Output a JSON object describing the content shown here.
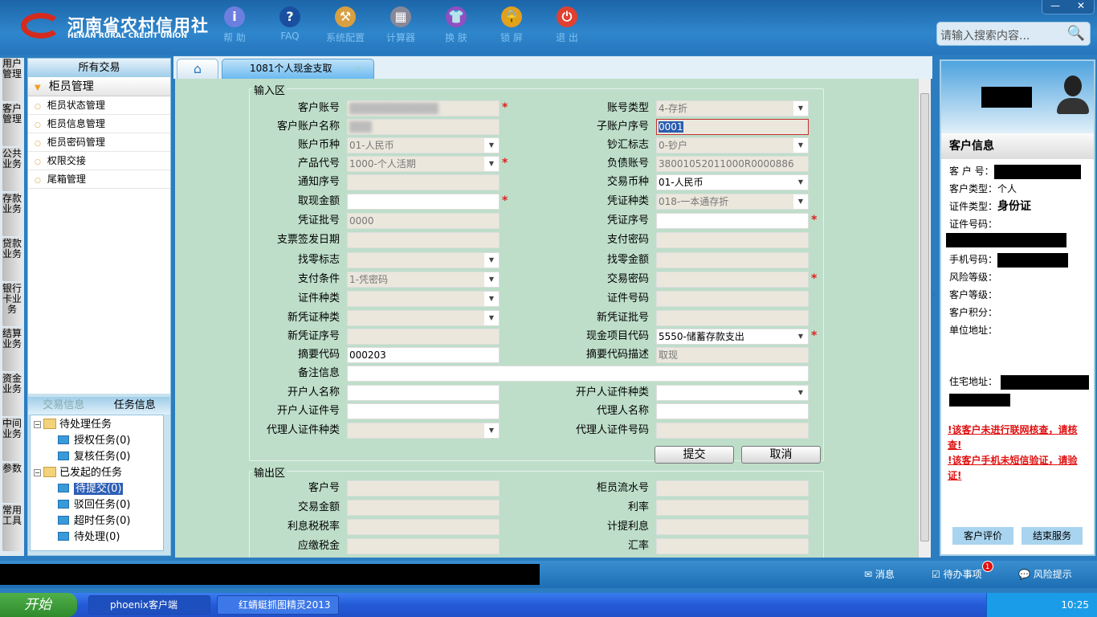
{
  "header": {
    "logo_cn": "河南省农村信用社",
    "logo_en": "HENAN RURAL CREDIT UNION",
    "tools": [
      {
        "label": "帮 助",
        "icon": "info-icon",
        "color": "#6c7fe0",
        "glyph": "i"
      },
      {
        "label": "FAQ",
        "icon": "question-icon",
        "color": "#1a4fa0",
        "glyph": "?"
      },
      {
        "label": "系统配置",
        "icon": "toolbox-icon",
        "color": "#d8a040",
        "glyph": "⚒"
      },
      {
        "label": "计算器",
        "icon": "calculator-icon",
        "color": "#889",
        "glyph": "▦"
      },
      {
        "label": "换 肤",
        "icon": "shirt-icon",
        "color": "#9050c0",
        "glyph": "👕"
      },
      {
        "label": "锁 屏",
        "icon": "lock-icon",
        "color": "#e0a020",
        "glyph": "🔒"
      },
      {
        "label": "退 出",
        "icon": "power-icon",
        "color": "#e04030",
        "glyph": "⏻"
      }
    ],
    "minimize": "—",
    "close": "✕",
    "search_placeholder": "请输入搜索内容..."
  },
  "vtabs": [
    "用户管理",
    "客户管理",
    "公共业务",
    "存款业务",
    "贷款业务",
    "银行卡业务",
    "结算业务",
    "资金业务",
    "中间业务",
    "参数",
    "常用工具"
  ],
  "left": {
    "title": "所有交易",
    "category": "柜员管理",
    "items": [
      "柜员状态管理",
      "柜员信息管理",
      "柜员密码管理",
      "权限交接",
      "尾箱管理"
    ],
    "tabs": [
      "交易信息",
      "任务信息"
    ],
    "tree": [
      {
        "label": "待处理任务",
        "children": [
          "授权任务(0)",
          "复核任务(0)"
        ]
      },
      {
        "label": "已发起的任务",
        "children": [
          "待提交(0)",
          "驳回任务(0)",
          "超时任务(0)",
          "待处理(0)"
        ]
      }
    ]
  },
  "tabs": {
    "active": "1081个人现金支取"
  },
  "form": {
    "input_title": "输入区",
    "output_title": "输出区",
    "submit": "提交",
    "cancel": "取消",
    "rows": [
      [
        {
          "label": "客户账号",
          "value": "████████████",
          "state": "blur",
          "req": true
        },
        {
          "label": "账号类型",
          "value": "4-存折",
          "state": "gray",
          "select": true
        }
      ],
      [
        {
          "label": "客户账户名称",
          "value": "███",
          "state": "blur"
        },
        {
          "label": "子账户序号",
          "value": "0001",
          "state": "active"
        }
      ],
      [
        {
          "label": "账户币种",
          "value": "01-人民币",
          "state": "gray",
          "select": true
        },
        {
          "label": "钞汇标志",
          "value": "0-钞户",
          "state": "gray",
          "select": true
        }
      ],
      [
        {
          "label": "产品代号",
          "value": "1000-个人活期",
          "state": "gray",
          "select": true,
          "req": true
        },
        {
          "label": "负债账号",
          "value": "38001052011000R0000886",
          "state": "gray"
        }
      ],
      [
        {
          "label": "通知序号",
          "value": "",
          "state": "gray"
        },
        {
          "label": "交易币种",
          "value": "01-人民币",
          "state": "white",
          "select": true
        }
      ],
      [
        {
          "label": "取现金额",
          "value": "",
          "state": "white",
          "req": true
        },
        {
          "label": "凭证种类",
          "value": "018-一本通存折",
          "state": "gray",
          "select": true
        }
      ],
      [
        {
          "label": "凭证批号",
          "value": "0000",
          "state": "gray"
        },
        {
          "label": "凭证序号",
          "value": "",
          "state": "white",
          "req": true
        }
      ],
      [
        {
          "label": "支票签发日期",
          "value": "",
          "state": "gray"
        },
        {
          "label": "支付密码",
          "value": "",
          "state": "gray"
        }
      ],
      [
        {
          "label": "找零标志",
          "value": "",
          "state": "gray",
          "select": true
        },
        {
          "label": "找零金额",
          "value": "",
          "state": "gray"
        }
      ],
      [
        {
          "label": "支付条件",
          "value": "1-凭密码",
          "state": "gray",
          "select": true
        },
        {
          "label": "交易密码",
          "value": "",
          "state": "gray",
          "req": true
        }
      ],
      [
        {
          "label": "证件种类",
          "value": "",
          "state": "gray",
          "select": true
        },
        {
          "label": "证件号码",
          "value": "",
          "state": "gray"
        }
      ],
      [
        {
          "label": "新凭证种类",
          "value": "",
          "state": "gray",
          "select": true
        },
        {
          "label": "新凭证批号",
          "value": "",
          "state": "gray"
        }
      ],
      [
        {
          "label": "新凭证序号",
          "value": "",
          "state": "gray"
        },
        {
          "label": "现金项目代码",
          "value": "5550-储蓄存款支出",
          "state": "white",
          "select": true,
          "req": true
        }
      ],
      [
        {
          "label": "摘要代码",
          "value": "000203",
          "state": "white"
        },
        {
          "label": "摘要代码描述",
          "value": "取现",
          "state": "gray"
        }
      ],
      [
        {
          "label": "备注信息",
          "value": "",
          "state": "white",
          "wide": true
        }
      ],
      [
        {
          "label": "开户人名称",
          "value": "",
          "state": "white"
        },
        {
          "label": "开户人证件种类",
          "value": "",
          "state": "white",
          "select": true
        }
      ],
      [
        {
          "label": "开户人证件号",
          "value": "",
          "state": "white"
        },
        {
          "label": "代理人名称",
          "value": "",
          "state": "white"
        }
      ],
      [
        {
          "label": "代理人证件种类",
          "value": "",
          "state": "gray",
          "select": true
        },
        {
          "label": "代理人证件号码",
          "value": "",
          "state": "gray"
        }
      ]
    ],
    "out_rows": [
      [
        {
          "label": "客户号",
          "value": "",
          "state": "gray"
        },
        {
          "label": "柜员流水号",
          "value": "",
          "state": "gray"
        }
      ],
      [
        {
          "label": "交易金额",
          "value": "",
          "state": "gray"
        },
        {
          "label": "利率",
          "value": "",
          "state": "gray"
        }
      ],
      [
        {
          "label": "利息税税率",
          "value": "",
          "state": "gray"
        },
        {
          "label": "计提利息",
          "value": "",
          "state": "gray"
        }
      ],
      [
        {
          "label": "应缴税金",
          "value": "",
          "state": "gray"
        },
        {
          "label": "汇率",
          "value": "",
          "state": "gray"
        }
      ]
    ]
  },
  "customer": {
    "title": "客户信息",
    "fields": [
      {
        "label": "客 户 号：",
        "value": ""
      },
      {
        "label": "客户类型：",
        "value": "个人"
      },
      {
        "label": "证件类型：",
        "value": "身份证"
      },
      {
        "label": "证件号码：",
        "value": ""
      },
      {
        "label": "手机号码：",
        "value": ""
      },
      {
        "label": "风险等级：",
        "value": ""
      },
      {
        "label": "客户等级：",
        "value": ""
      },
      {
        "label": "客户积分：",
        "value": ""
      },
      {
        "label": "单位地址：",
        "value": ""
      },
      {
        "label": "住宅地址：",
        "value": ""
      }
    ],
    "warnings": [
      "!该客户未进行联网核查，请核查!",
      "!该客户手机未短信验证，请验证!"
    ],
    "btn_rate": "客户评价",
    "btn_end": "结束服务"
  },
  "status": {
    "messages": "消息",
    "todo": "待办事项",
    "todo_badge": "1",
    "risk": "风险提示"
  },
  "taskbar": {
    "start": "开始",
    "apps": [
      "phoenix客户端",
      "红蜻蜓抓图精灵2013"
    ],
    "time": "10:25"
  }
}
